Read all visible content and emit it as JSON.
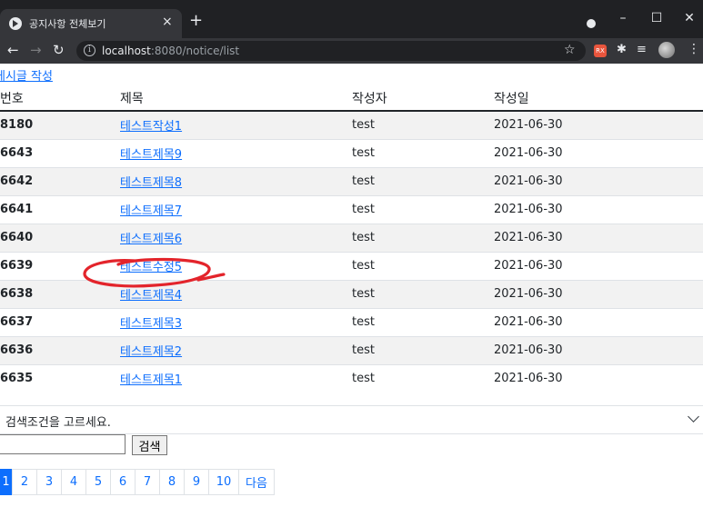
{
  "browser": {
    "tab_title": "공지사항 전체보기",
    "url_host": "localhost",
    "url_rest": ":8080/notice/list",
    "ext_badge": "RX"
  },
  "page": {
    "write_link": "게시글 작성",
    "headers": {
      "no": "번호",
      "title": "제목",
      "author": "작성자",
      "date": "작성일"
    },
    "rows": [
      {
        "no": "8180",
        "title": "테스트작성1",
        "author": "test",
        "date": "2021-06-30"
      },
      {
        "no": "6643",
        "title": "테스트제목9",
        "author": "test",
        "date": "2021-06-30"
      },
      {
        "no": "6642",
        "title": "테스트제목8",
        "author": "test",
        "date": "2021-06-30"
      },
      {
        "no": "6641",
        "title": "테스트제목7",
        "author": "test",
        "date": "2021-06-30"
      },
      {
        "no": "6640",
        "title": "테스트제목6",
        "author": "test",
        "date": "2021-06-30"
      },
      {
        "no": "6639",
        "title": "테스트수정5",
        "author": "test",
        "date": "2021-06-30"
      },
      {
        "no": "6638",
        "title": "테스트제목4",
        "author": "test",
        "date": "2021-06-30"
      },
      {
        "no": "6637",
        "title": "테스트제목3",
        "author": "test",
        "date": "2021-06-30"
      },
      {
        "no": "6636",
        "title": "테스트제목2",
        "author": "test",
        "date": "2021-06-30"
      },
      {
        "no": "6635",
        "title": "테스트제목1",
        "author": "test",
        "date": "2021-06-30"
      }
    ],
    "search": {
      "select_label": "검색조건을 고르세요.",
      "keyword_value": "",
      "button_label": "검색"
    },
    "pagination": {
      "pages": [
        "1",
        "2",
        "3",
        "4",
        "5",
        "6",
        "7",
        "8",
        "9",
        "10"
      ],
      "next_label": "다음",
      "active": "1"
    }
  },
  "colors": {
    "link": "#0d6efd",
    "annotation": "#e3242b",
    "stripe": "#f2f2f2"
  }
}
